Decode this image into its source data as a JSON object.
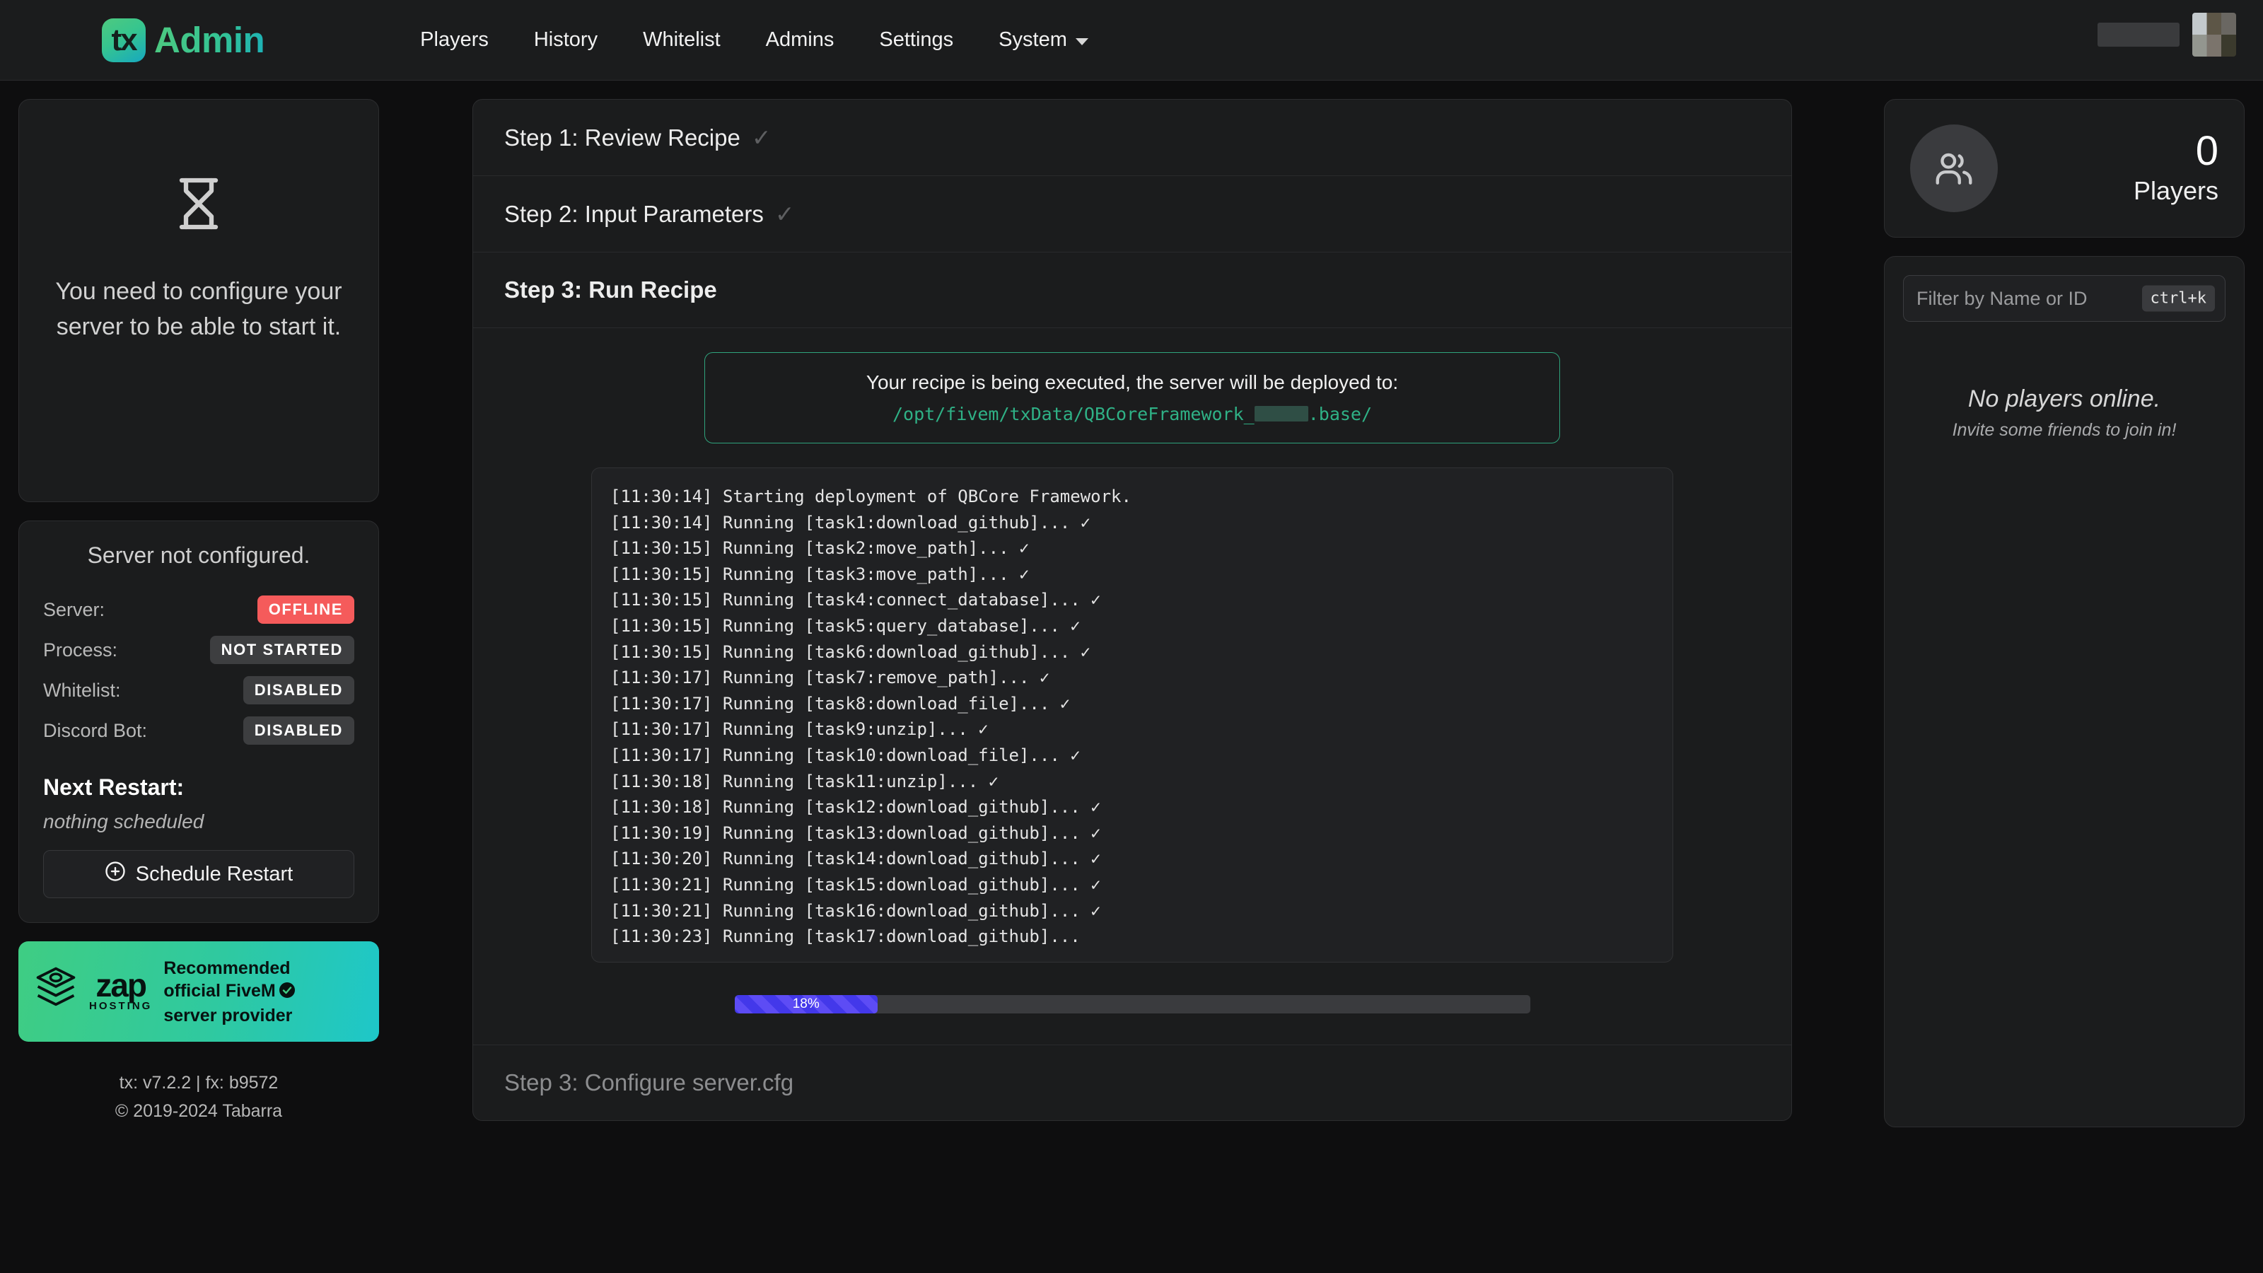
{
  "brand": {
    "mark": "tx",
    "name": "Admin"
  },
  "nav": {
    "items": [
      {
        "label": "Players"
      },
      {
        "label": "History"
      },
      {
        "label": "Whitelist"
      },
      {
        "label": "Admins"
      },
      {
        "label": "Settings"
      },
      {
        "label": "System"
      }
    ]
  },
  "sidebar": {
    "notice": {
      "icon": "hourglass-icon",
      "text": "You need to configure your server to be able to start it."
    },
    "status": {
      "title": "Server not configured.",
      "rows": [
        {
          "label": "Server:",
          "value": "OFFLINE",
          "tone": "red"
        },
        {
          "label": "Process:",
          "value": "NOT STARTED",
          "tone": "gray"
        },
        {
          "label": "Whitelist:",
          "value": "DISABLED",
          "tone": "gray"
        },
        {
          "label": "Discord Bot:",
          "value": "DISABLED",
          "tone": "gray"
        }
      ],
      "next_restart_label": "Next Restart:",
      "next_restart_value": "nothing scheduled",
      "schedule_button": "Schedule Restart"
    },
    "zap": {
      "word": "zap",
      "sub": "HOSTING",
      "line1": "Recommended",
      "line2": "official FiveM",
      "line3": "server provider"
    },
    "footer": {
      "versions": "tx: v7.2.2 | fx: b9572",
      "copyright": "© 2019-2024 Tabarra"
    }
  },
  "main": {
    "steps": [
      {
        "label": "Step 1: Review Recipe",
        "check": "✓",
        "state": "done"
      },
      {
        "label": "Step 2: Input Parameters",
        "check": "✓",
        "state": "done"
      },
      {
        "label": "Step 3: Run Recipe",
        "check": "",
        "state": "active"
      }
    ],
    "final_step": {
      "label": "Step 3: Configure server.cfg",
      "state": "disabled"
    },
    "deploy": {
      "message": "Your recipe is being executed, the server will be deployed to:",
      "path_prefix": "/opt/fivem/txData/QBCoreFramework_",
      "path_suffix": ".base/"
    },
    "terminal": {
      "lines": [
        "[11:30:14] Starting deployment of QBCore Framework.",
        "[11:30:14] Running [task1:download_github]... ✓",
        "[11:30:15] Running [task2:move_path]... ✓",
        "[11:30:15] Running [task3:move_path]... ✓",
        "[11:30:15] Running [task4:connect_database]... ✓",
        "[11:30:15] Running [task5:query_database]... ✓",
        "[11:30:15] Running [task6:download_github]... ✓",
        "[11:30:17] Running [task7:remove_path]... ✓",
        "[11:30:17] Running [task8:download_file]... ✓",
        "[11:30:17] Running [task9:unzip]... ✓",
        "[11:30:17] Running [task10:download_file]... ✓",
        "[11:30:18] Running [task11:unzip]... ✓",
        "[11:30:18] Running [task12:download_github]... ✓",
        "[11:30:19] Running [task13:download_github]... ✓",
        "[11:30:20] Running [task14:download_github]... ✓",
        "[11:30:21] Running [task15:download_github]... ✓",
        "[11:30:21] Running [task16:download_github]... ✓",
        "[11:30:23] Running [task17:download_github]..."
      ]
    },
    "progress": {
      "percent": 18,
      "label": "18%"
    }
  },
  "right": {
    "players": {
      "count": "0",
      "label": "Players",
      "icon": "users-icon"
    },
    "filter": {
      "placeholder": "Filter by Name or ID",
      "shortcut": "ctrl+k"
    },
    "empty": {
      "title": "No players online.",
      "subtitle": "Invite some friends to join in!"
    }
  },
  "colors": {
    "accent_green": "#2fb186",
    "offline_red": "#f55b5b",
    "progress_indigo": "#4338ea",
    "brand_gradient_start": "#4ec97f",
    "brand_gradient_end": "#1cb1b8"
  }
}
